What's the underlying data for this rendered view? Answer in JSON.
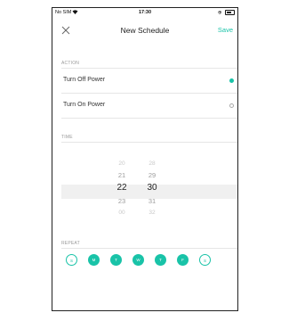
{
  "status_bar": {
    "carrier": "No SIM",
    "time": "17:30",
    "right_text": "⊕"
  },
  "header": {
    "title": "New Schedule",
    "save_label": "Save"
  },
  "action": {
    "section_label": "ACTION",
    "options": [
      {
        "label": "Turn Off Power",
        "selected": true
      },
      {
        "label": "Turn On Power",
        "selected": false
      }
    ]
  },
  "time": {
    "section_label": "TIME",
    "hours": [
      "20",
      "21",
      "22",
      "23",
      "00"
    ],
    "hour_top_fade": "",
    "minutes_top_fade": "",
    "minutes": [
      "28",
      "29",
      "30",
      "31",
      "32"
    ],
    "selected_hour": "22",
    "selected_minute": "30"
  },
  "repeat": {
    "section_label": "REPEAT",
    "days": [
      {
        "label": "S",
        "active": false
      },
      {
        "label": "M",
        "active": true
      },
      {
        "label": "T",
        "active": true
      },
      {
        "label": "W",
        "active": true
      },
      {
        "label": "T",
        "active": true
      },
      {
        "label": "F",
        "active": true
      },
      {
        "label": "S",
        "active": false
      }
    ]
  },
  "colors": {
    "accent": "#19c3a8"
  }
}
